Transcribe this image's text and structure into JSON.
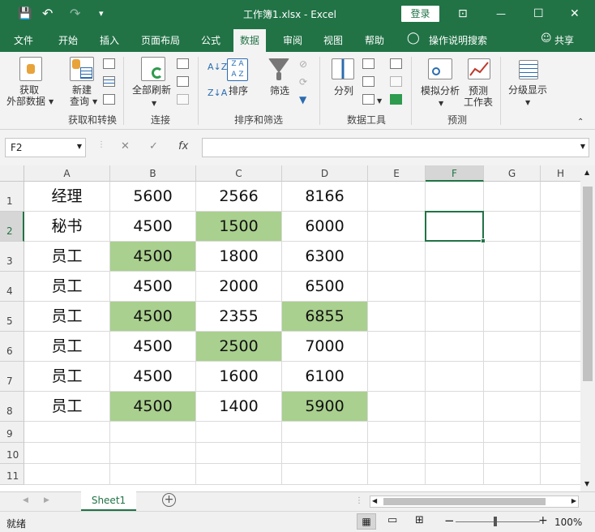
{
  "titlebar": {
    "title": "工作簿1.xlsx  -  Excel",
    "login": "登录",
    "save_icon": "💾",
    "undo_icon": "↶",
    "redo_icon": "↷",
    "customize_icon": "▾",
    "ribbon_display_icon": "⊡",
    "minimize_icon": "—",
    "maximize_icon": "☐",
    "close_icon": "✕"
  },
  "tabs": [
    "文件",
    "开始",
    "插入",
    "页面布局",
    "公式",
    "数据",
    "审阅",
    "视图",
    "帮助"
  ],
  "active_tab": "数据",
  "tell_me": "操作说明搜索",
  "share": "共享",
  "ribbon": {
    "get_external": "获取",
    "get_external2": "外部数据",
    "new_query": "新建",
    "new_query2": "查询",
    "refresh_all": "全部刷新",
    "sort": "排序",
    "filter": "筛选",
    "text_to_columns": "分列",
    "what_if": "模拟分析",
    "forecast": "预测",
    "forecast2": "工作表",
    "outline": "分级显示",
    "groups": [
      "获取和转换",
      "连接",
      "排序和筛选",
      "数据工具",
      "预测"
    ]
  },
  "formula_bar": {
    "name_box": "F2",
    "cancel_icon": "✕",
    "enter_icon": "✓",
    "fx": "fx",
    "value": ""
  },
  "columns": [
    "A",
    "B",
    "C",
    "D",
    "E",
    "F",
    "G",
    "H"
  ],
  "selected_column": "F",
  "rows": [
    "1",
    "2",
    "3",
    "4",
    "5",
    "6",
    "7",
    "8",
    "9",
    "10",
    "11"
  ],
  "selected_row": "2",
  "cells": [
    [
      "经理",
      "5600",
      "2566",
      "8166"
    ],
    [
      "秘书",
      "4500",
      "1500",
      "6000"
    ],
    [
      "员工",
      "4500",
      "1800",
      "6300"
    ],
    [
      "员工",
      "4500",
      "2000",
      "6500"
    ],
    [
      "员工",
      "4500",
      "2355",
      "6855"
    ],
    [
      "员工",
      "4500",
      "2500",
      "7000"
    ],
    [
      "员工",
      "4500",
      "1600",
      "6100"
    ],
    [
      "员工",
      "4500",
      "1400",
      "5900"
    ]
  ],
  "highlight_color": "#a9d08e",
  "accent_color": "#217346",
  "sheet_tab": "Sheet1",
  "status": {
    "ready": "就绪",
    "zoom": "100%"
  }
}
